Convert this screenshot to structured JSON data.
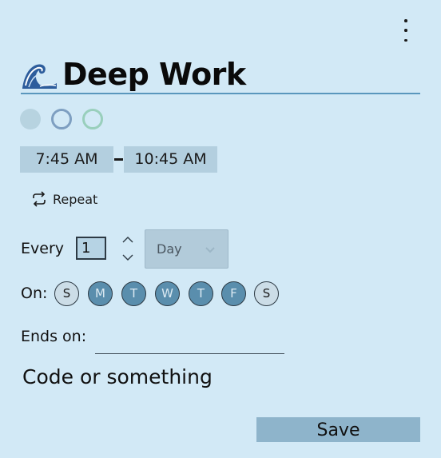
{
  "event": {
    "emoji_icon": "wave-icon",
    "title": "Deep Work"
  },
  "colors": [
    {
      "name": "filled",
      "fill": "#b7d3e0",
      "border": "#b7d3e0"
    },
    {
      "name": "blue",
      "fill": "transparent",
      "border": "#7e9fc1"
    },
    {
      "name": "green",
      "fill": "transparent",
      "border": "#99cfbc"
    }
  ],
  "time": {
    "start": "7:45 AM",
    "end": "10:45 AM"
  },
  "repeat": {
    "label": "Repeat",
    "every_label": "Every",
    "interval": "1",
    "unit": "Day",
    "on_label": "On:",
    "days": [
      {
        "letter": "S",
        "selected": false
      },
      {
        "letter": "M",
        "selected": true
      },
      {
        "letter": "T",
        "selected": true
      },
      {
        "letter": "W",
        "selected": true
      },
      {
        "letter": "T",
        "selected": true
      },
      {
        "letter": "F",
        "selected": true
      },
      {
        "letter": "S",
        "selected": false
      }
    ],
    "ends_label": "Ends on:",
    "ends_value": ""
  },
  "notes": "Code or something",
  "save_label": "Save",
  "accent": "#5a8ead"
}
